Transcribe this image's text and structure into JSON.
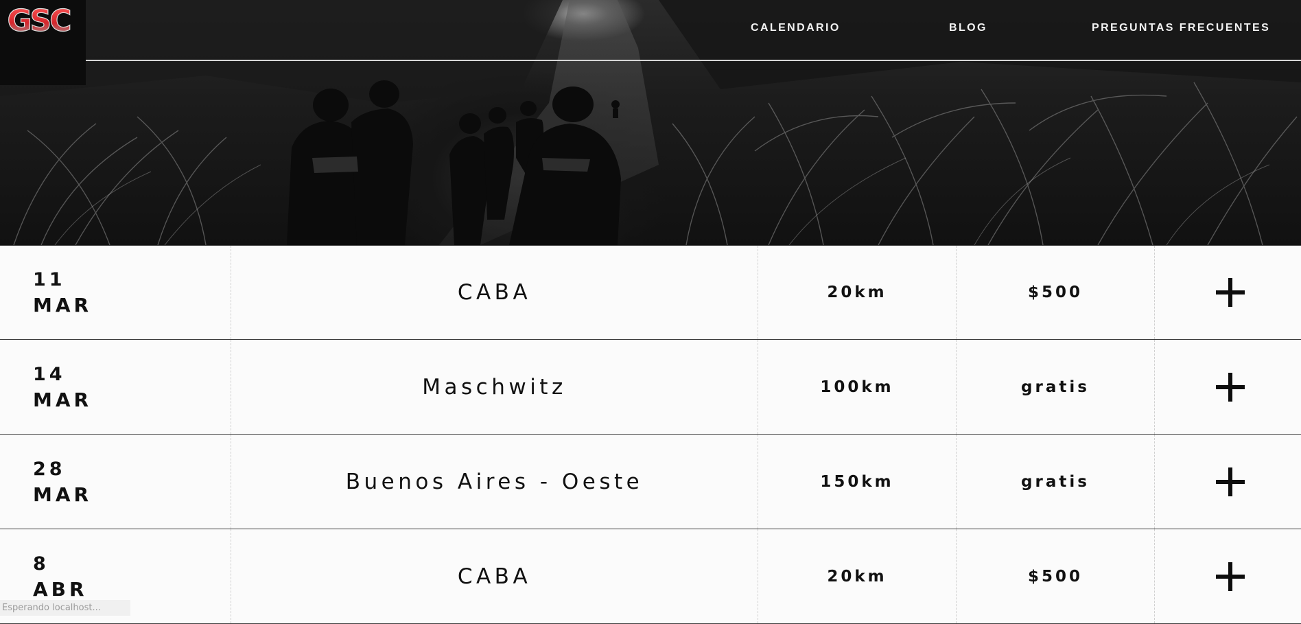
{
  "brand": {
    "logo_text": "GSC",
    "colors": {
      "logo_red": "#d6262c",
      "logo_grey": "#b8b8b8"
    }
  },
  "nav": {
    "items": [
      {
        "label": "CALENDARIO"
      },
      {
        "label": "BLOG"
      },
      {
        "label": "PREGUNTAS FRECUENTES"
      }
    ]
  },
  "hero": {
    "image": "black-and-white photo of cyclists riding on a grassy trail"
  },
  "events": [
    {
      "day": "11",
      "month": "MAR",
      "place": "CABA",
      "distance": "20km",
      "price": "$500",
      "expand_icon": "plus-icon"
    },
    {
      "day": "14",
      "month": "MAR",
      "place": "Maschwitz",
      "distance": "100km",
      "price": "gratis",
      "expand_icon": "plus-icon"
    },
    {
      "day": "28",
      "month": "MAR",
      "place": "Buenos Aires - Oeste",
      "distance": "150km",
      "price": "gratis",
      "expand_icon": "plus-icon"
    },
    {
      "day": "8",
      "month": "ABR",
      "place": "CABA",
      "distance": "20km",
      "price": "$500",
      "expand_icon": "plus-icon"
    }
  ],
  "status_bar": {
    "text": "Esperando localhost..."
  }
}
